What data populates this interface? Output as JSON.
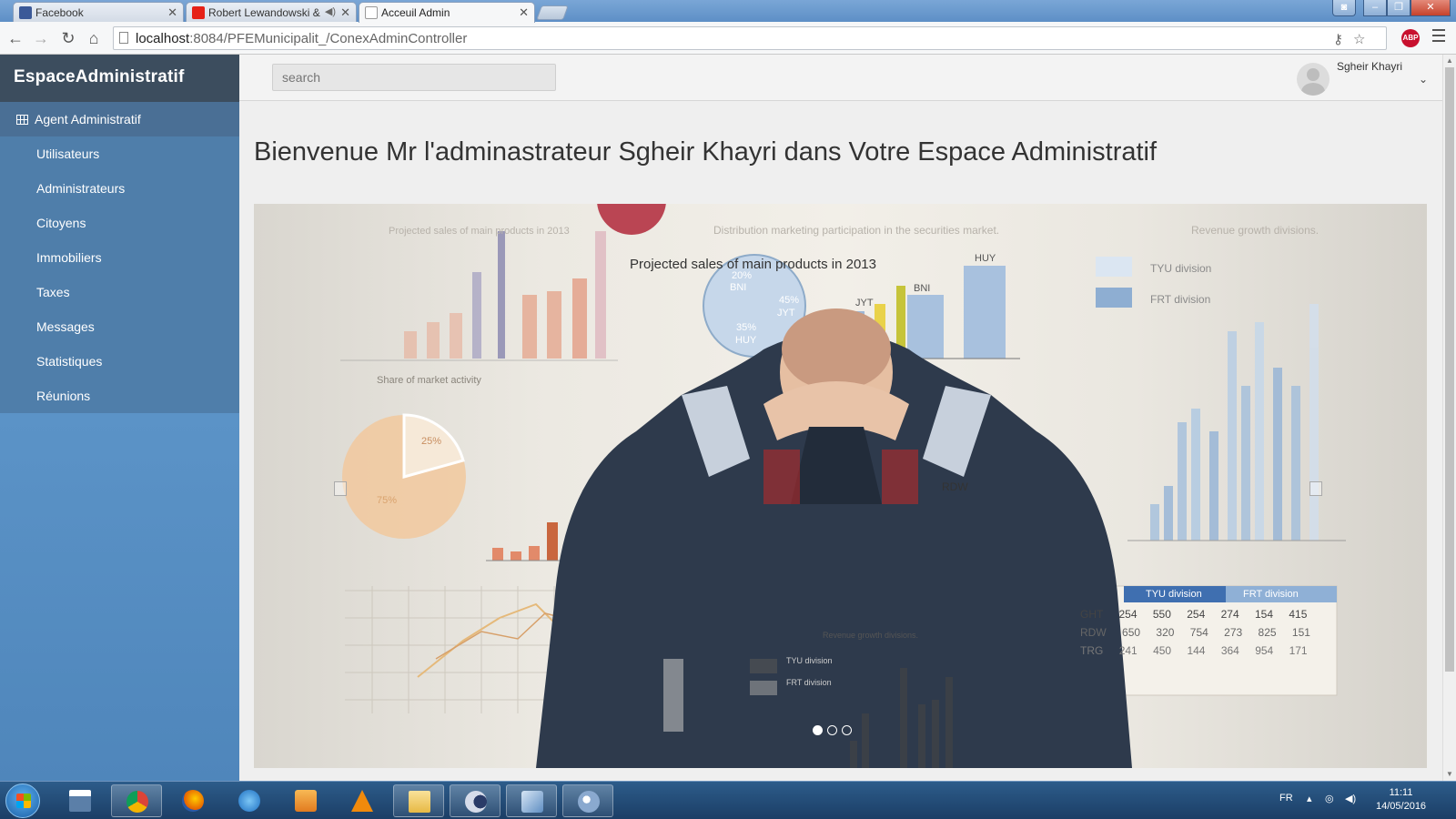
{
  "browser": {
    "tabs": [
      {
        "title": "Facebook",
        "active": false
      },
      {
        "title": "Robert Lewandowski &",
        "active": false
      },
      {
        "title": "Acceuil Admin",
        "active": true
      }
    ],
    "url_host": "localhost",
    "url_path": ":8084/PFEMunicipalit_/ConexAdminController",
    "abp_label": "ABP"
  },
  "sidebar": {
    "brand": "EspaceAdministratif",
    "section_title": "Agent Administratif",
    "items": [
      {
        "label": "Utilisateurs"
      },
      {
        "label": "Administrateurs"
      },
      {
        "label": "Citoyens"
      },
      {
        "label": "Immobiliers"
      },
      {
        "label": "Taxes"
      },
      {
        "label": "Messages"
      },
      {
        "label": "Statistiques"
      },
      {
        "label": "Réunions"
      }
    ]
  },
  "header": {
    "search_placeholder": "search",
    "user_name": "Sgheir Khayri"
  },
  "main": {
    "welcome": "Bienvenue Mr l'adminastrateur Sgheir Khayri dans Votre Espace Administratif"
  },
  "carousel": {
    "slide_count": 3,
    "active_slide": 1,
    "image_texts": {
      "main_title": "Projected sales of main products in 2013",
      "faint_title_1": "Projected sales of main products in 2013",
      "faint_title_2": "Distribution marketing participation in the securities market.",
      "faint_title_3": "Revenue growth divisions.",
      "share_title": "Share of market activity",
      "legend_tyu": "TYU division",
      "legend_frt": "FRT division",
      "pie_labels": [
        "20%",
        "BNI",
        "45%",
        "JYT",
        "35%",
        "HUY"
      ],
      "bar_labels": [
        "JYT",
        "BNI",
        "HUY"
      ],
      "share_pct": [
        "25%",
        "75%"
      ],
      "rdw": "RDW",
      "revenue_caption": "Revenue growth divisions.",
      "table_header": [
        "TYU division",
        "FRT division"
      ],
      "table_rows": [
        [
          "GHT",
          "254",
          "550",
          "254",
          "274",
          "154",
          "415"
        ],
        [
          "RDW",
          "650",
          "320",
          "754",
          "273",
          "825",
          "151"
        ],
        [
          "TRG",
          "241",
          "450",
          "144",
          "364",
          "954",
          "171"
        ]
      ]
    }
  },
  "taskbar": {
    "lang": "FR",
    "time": "11:11",
    "date": "14/05/2016"
  }
}
